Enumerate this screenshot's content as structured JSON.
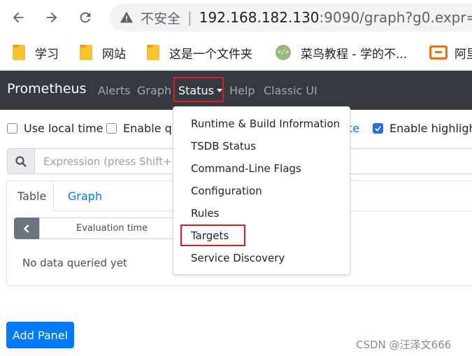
{
  "browser": {
    "insecure_label": "不安全",
    "host": "192.168.182.130",
    "path": ":9090/graph?g0.expr="
  },
  "bookmarks": [
    {
      "label": "学习",
      "icon": "folder-icon"
    },
    {
      "label": "网站",
      "icon": "folder-icon"
    },
    {
      "label": "这是一个文件夹",
      "icon": "folder-icon"
    },
    {
      "label": "菜鸟教程 - 学的不...",
      "icon": "runoob-icon"
    },
    {
      "label": "阿里",
      "icon": "aliyun-icon"
    }
  ],
  "navbar": {
    "brand": "Prometheus",
    "links": [
      "Alerts",
      "Graph",
      "Status",
      "Help",
      "Classic UI"
    ]
  },
  "options": {
    "use_local_time": "Use local time",
    "enable_query": "Enable que",
    "partial": "te",
    "enable_highlighting": "Enable highlighti"
  },
  "expression": {
    "placeholder": "Expression (press Shift+Ente"
  },
  "panel": {
    "tab_table": "Table",
    "tab_graph": "Graph",
    "eval_time": "Evaluation time",
    "no_data": "No data queried yet"
  },
  "add_panel": "Add Panel",
  "status_menu": [
    "Runtime & Build Information",
    "TSDB Status",
    "Command-Line Flags",
    "Configuration",
    "Rules",
    "Targets",
    "Service Discovery"
  ],
  "watermark": "CSDN @汪泽文666",
  "colors": {
    "navbar_bg": "#343a40",
    "primary": "#007bff",
    "highlight_box": "#e21b1b"
  }
}
